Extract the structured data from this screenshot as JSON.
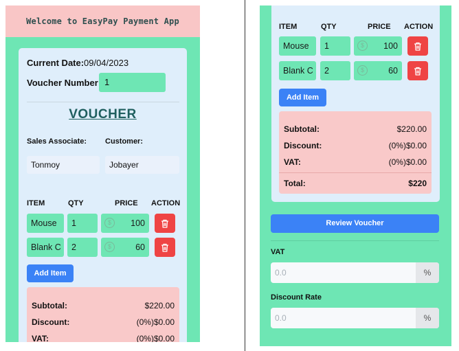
{
  "app": {
    "welcome": "Welcome to EasyPay Payment App"
  },
  "meta": {
    "date_label": "Current Date:",
    "date_value": "09/04/2023",
    "voucher_number_label": "Voucher Number:",
    "voucher_number_value": "1"
  },
  "voucher_title": "VOUCHER",
  "parties": {
    "sales_associate_label": "Sales Associate:",
    "sales_associate": "Tonmoy",
    "customer_label": "Customer:",
    "customer": "Jobayer"
  },
  "table": {
    "headers": {
      "item": "ITEM",
      "qty": "QTY",
      "price": "PRICE",
      "action": "ACTION"
    },
    "rows": [
      {
        "name": "Mouse",
        "qty": "1",
        "price": "100"
      },
      {
        "name": "Blank C",
        "qty": "2",
        "price": "60"
      }
    ],
    "add_item_label": "Add Item",
    "currency_icon": "dollar-circle-icon",
    "delete_icon": "trash-icon"
  },
  "summary": {
    "subtotal_label": "Subtotal:",
    "subtotal": "$220.00",
    "discount_label": "Discount:",
    "discount": "(0%)$0.00",
    "vat_label": "VAT:",
    "vat": "(0%)$0.00",
    "total_label": "Total:",
    "total": "$220"
  },
  "actions": {
    "review_label": "Review Voucher"
  },
  "fields": {
    "vat_label": "VAT",
    "vat_value": "0.0",
    "vat_suffix": "%",
    "discount_label": "Discount Rate",
    "discount_value": "0.0",
    "discount_suffix": "%"
  },
  "colors": {
    "app_green": "#6ee6b4",
    "header_pink": "#f9c6c6",
    "card_blue": "#dfeefb",
    "summary_pink": "#f9c9c9",
    "button_blue": "#3b82f6",
    "delete_red": "#ef4444"
  }
}
